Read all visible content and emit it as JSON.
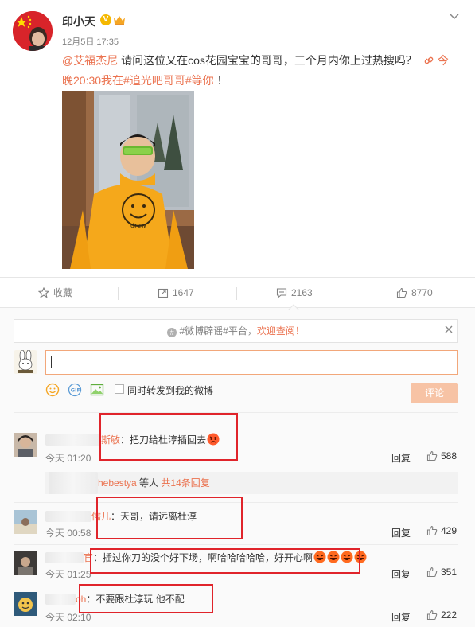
{
  "post": {
    "author": "印小天",
    "time": "12月5日 17:35",
    "mention": "@艾福杰尼",
    "text_main": " 请问这位又在cos花园宝宝的哥哥，三个月内你上过热搜吗？",
    "link_icon": "link-icon",
    "link_text_1": "今",
    "link_text_2": "晚20:30我在#追光吧哥哥#等你",
    "text_end": " ！"
  },
  "actions": {
    "favorite_label": "收藏",
    "repost_count": "1647",
    "comment_count": "2163",
    "like_count": "8770"
  },
  "notice": {
    "topic": "#微博辟谣#平台",
    "sep": "，",
    "welcome": "欢迎查阅！"
  },
  "composer": {
    "repost_label": "同时转发到我的微博",
    "submit_label": "评论"
  },
  "comments": [
    {
      "name_tail": "斯敏",
      "text": "：把刀给杜淳插回去",
      "time": "今天 01:20",
      "reply": "回复",
      "likes": "588"
    },
    {
      "name_tail": "儒儿",
      "text": "：天哥，请远离杜淳",
      "time": "今天 00:58",
      "reply": "回复",
      "likes": "429"
    },
    {
      "name_tail": "官",
      "text": "：插过你刀的没个好下场，啊哈哈哈哈哈，好开心啊",
      "time": "今天 01:25",
      "reply": "回复",
      "likes": "351"
    },
    {
      "name_tail": "oh",
      "text": "：不要跟杜淳玩 他不配",
      "time": "今天 02:10",
      "reply": "回复",
      "likes": "222"
    }
  ],
  "subreply": {
    "name_tail": "hebestya",
    "text": " 等人",
    "count": "共14条回复"
  },
  "colors": {
    "accent": "#eb7350",
    "highlight_box": "#e0242b",
    "link_blue": "#eb7350"
  }
}
